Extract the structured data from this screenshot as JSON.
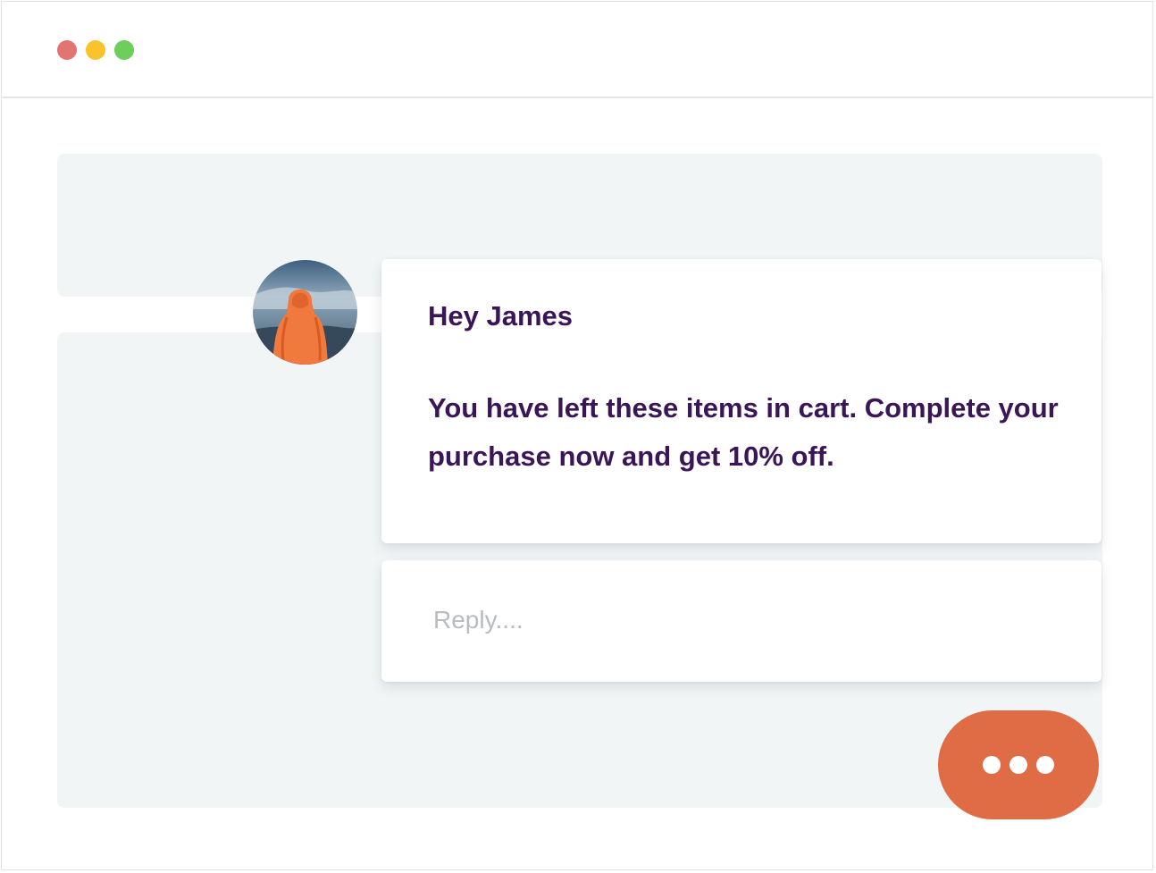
{
  "window": {
    "controls": [
      {
        "name": "close",
        "color": "#e27471"
      },
      {
        "name": "minimize",
        "color": "#fbc22b"
      },
      {
        "name": "maximize",
        "color": "#6ccf5a"
      }
    ]
  },
  "message": {
    "greeting": "Hey James",
    "body": "You have left these items in cart. Complete your purchase now and get 10% off.",
    "text_color": "#3a1557",
    "avatar_icon": "person-in-orange-hood-photo"
  },
  "reply": {
    "placeholder": "Reply....",
    "value": ""
  },
  "actions": {
    "more_icon": "ellipsis-icon",
    "more_color": "#e06c45"
  }
}
